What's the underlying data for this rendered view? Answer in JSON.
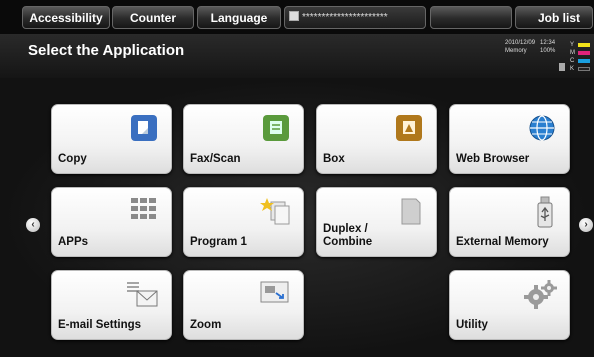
{
  "top_bar": {
    "accessibility": "Accessibility",
    "counter": "Counter",
    "language": "Language",
    "user_field": "**********************",
    "job_list": "Job list"
  },
  "header": {
    "title": "Select the Application",
    "date": "2010/12/09",
    "time": "12:34",
    "memory_label": "Memory",
    "memory_value": "100%",
    "toner": [
      {
        "letter": "Y",
        "color": "#f2e21a"
      },
      {
        "letter": "M",
        "color": "#e0227a"
      },
      {
        "letter": "C",
        "color": "#1aa0e0"
      },
      {
        "letter": "K",
        "color": "#333333"
      }
    ]
  },
  "apps": [
    {
      "label": "Copy",
      "icon": "copy-icon"
    },
    {
      "label": "Fax/Scan",
      "icon": "fax-scan-icon"
    },
    {
      "label": "Box",
      "icon": "box-icon"
    },
    {
      "label": "Web Browser",
      "icon": "web-browser-icon"
    },
    {
      "label": "APPs",
      "icon": "apps-grid-icon"
    },
    {
      "label": "Program 1",
      "icon": "program-icon"
    },
    {
      "label_line1": "Duplex /",
      "label_line2": "Combine",
      "icon": "duplex-icon"
    },
    {
      "label": "External Memory",
      "icon": "usb-icon"
    },
    {
      "label": "E-mail Settings",
      "icon": "email-icon"
    },
    {
      "label": "Zoom",
      "icon": "zoom-icon"
    },
    {
      "label": "Utility",
      "icon": "gear-icon"
    }
  ],
  "nav": {
    "left": "‹",
    "right": "›"
  }
}
